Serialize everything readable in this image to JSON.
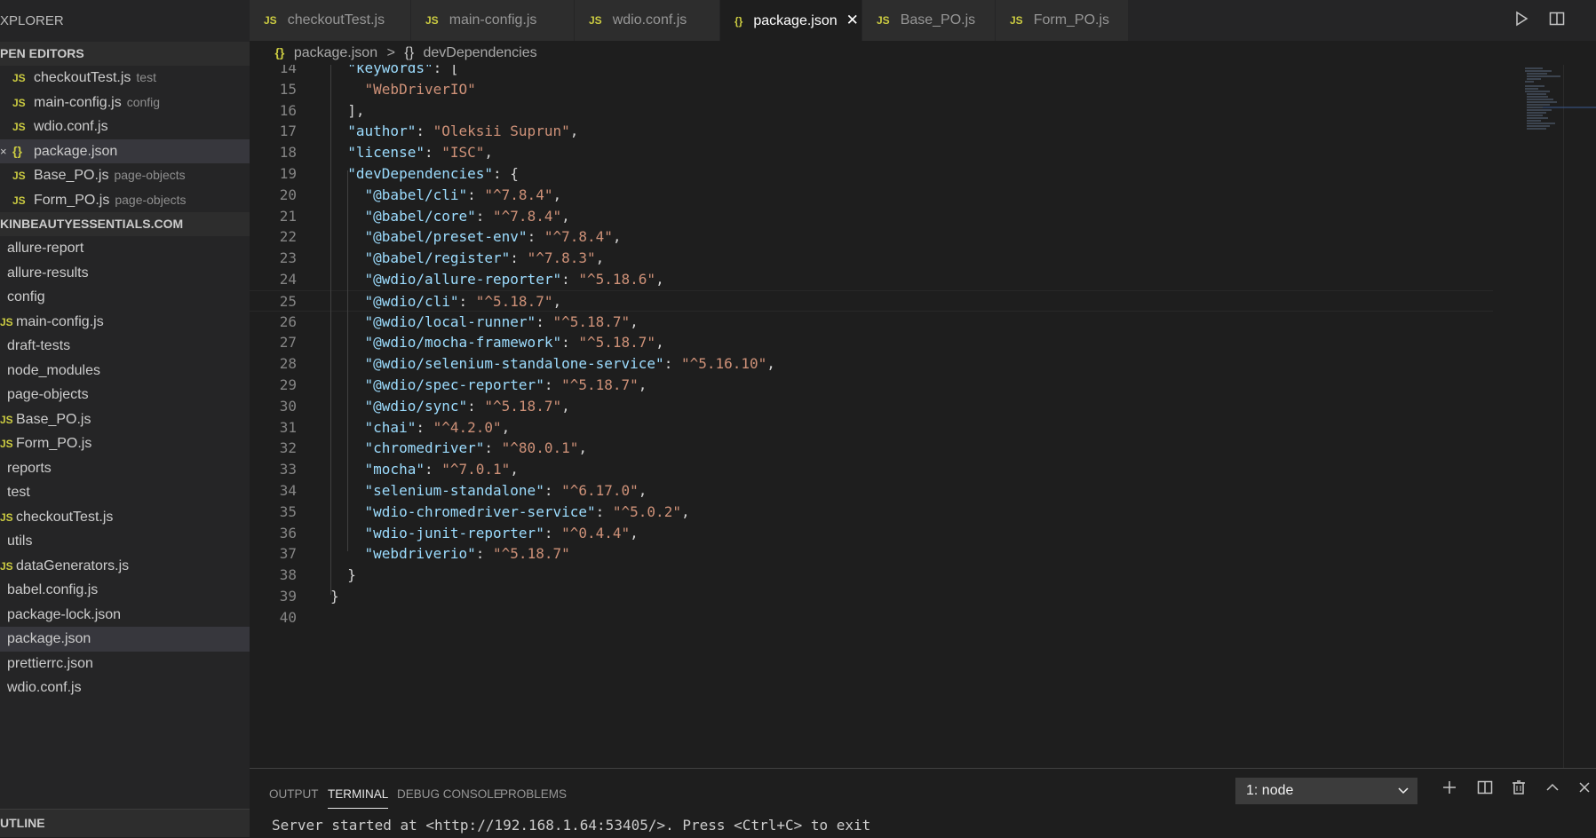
{
  "sidebar": {
    "header": "XPLORER",
    "open_editors_title": "PEN EDITORS",
    "open_editors": [
      {
        "icon": "JS",
        "name": "checkoutTest.js",
        "desc": "test"
      },
      {
        "icon": "JS",
        "name": "main-config.js",
        "desc": "config"
      },
      {
        "icon": "JS",
        "name": "wdio.conf.js",
        "desc": ""
      },
      {
        "icon": "{}",
        "name": "package.json",
        "desc": "",
        "close": "×"
      },
      {
        "icon": "JS",
        "name": "Base_PO.js",
        "desc": "page-objects"
      },
      {
        "icon": "JS",
        "name": "Form_PO.js",
        "desc": "page-objects"
      }
    ],
    "project_title": "KINBEAUTYESSENTIALS.COM",
    "tree": [
      {
        "icon": "",
        "name": "allure-report"
      },
      {
        "icon": "",
        "name": "allure-results"
      },
      {
        "icon": "",
        "name": "config"
      },
      {
        "icon": "JS",
        "name": "main-config.js"
      },
      {
        "icon": "",
        "name": "draft-tests"
      },
      {
        "icon": "",
        "name": "node_modules"
      },
      {
        "icon": "",
        "name": "page-objects"
      },
      {
        "icon": "JS",
        "name": "Base_PO.js"
      },
      {
        "icon": "JS",
        "name": "Form_PO.js"
      },
      {
        "icon": "",
        "name": "reports"
      },
      {
        "icon": "",
        "name": "test"
      },
      {
        "icon": "JS",
        "name": "checkoutTest.js"
      },
      {
        "icon": "",
        "name": "utils"
      },
      {
        "icon": "JS",
        "name": "dataGenerators.js"
      },
      {
        "icon": "",
        "name": "babel.config.js"
      },
      {
        "icon": "",
        "name": "package-lock.json"
      },
      {
        "icon": "",
        "name": "package.json"
      },
      {
        "icon": "",
        "name": "prettierrc.json"
      },
      {
        "icon": "",
        "name": "wdio.conf.js"
      }
    ],
    "outline_title": "UTLINE"
  },
  "tabs": [
    {
      "icon": "JS",
      "label": "checkoutTest.js"
    },
    {
      "icon": "JS",
      "label": "main-config.js"
    },
    {
      "icon": "JS",
      "label": "wdio.conf.js"
    },
    {
      "icon": "{}",
      "label": "package.json",
      "close": "✕"
    },
    {
      "icon": "JS",
      "label": "Base_PO.js"
    },
    {
      "icon": "JS",
      "label": "Form_PO.js"
    }
  ],
  "breadcrumb": {
    "file_icon": "{}",
    "file": "package.json",
    "sep": ">",
    "node_icon": "{}",
    "node": "devDependencies"
  },
  "editor": {
    "lines": [
      {
        "n": "14",
        "indent": "  ",
        "key": "\"keywords\"",
        "value": "",
        "punct": ": ["
      },
      {
        "n": "15",
        "indent": "    ",
        "key": "",
        "value": "\"WebDriverIO\"",
        "punct": ""
      },
      {
        "n": "16",
        "indent": "  ",
        "key": "",
        "value": "",
        "punct": "],"
      },
      {
        "n": "17",
        "indent": "  ",
        "key": "\"author\"",
        "value": "\"Oleksii Suprun\"",
        "punct": ","
      },
      {
        "n": "18",
        "indent": "  ",
        "key": "\"license\"",
        "value": "\"ISC\"",
        "punct": ","
      },
      {
        "n": "19",
        "indent": "  ",
        "key": "\"devDependencies\"",
        "value": "",
        "punct": ": {"
      },
      {
        "n": "20",
        "indent": "    ",
        "key": "\"@babel/cli\"",
        "value": "\"^7.8.4\"",
        "punct": ","
      },
      {
        "n": "21",
        "indent": "    ",
        "key": "\"@babel/core\"",
        "value": "\"^7.8.4\"",
        "punct": ","
      },
      {
        "n": "22",
        "indent": "    ",
        "key": "\"@babel/preset-env\"",
        "value": "\"^7.8.4\"",
        "punct": ","
      },
      {
        "n": "23",
        "indent": "    ",
        "key": "\"@babel/register\"",
        "value": "\"^7.8.3\"",
        "punct": ","
      },
      {
        "n": "24",
        "indent": "    ",
        "key": "\"@wdio/allure-reporter\"",
        "value": "\"^5.18.6\"",
        "punct": ","
      },
      {
        "n": "25",
        "indent": "    ",
        "key": "\"@wdio/cli\"",
        "value": "\"^5.18.7\"",
        "punct": ","
      },
      {
        "n": "26",
        "indent": "    ",
        "key": "\"@wdio/local-runner\"",
        "value": "\"^5.18.7\"",
        "punct": ","
      },
      {
        "n": "27",
        "indent": "    ",
        "key": "\"@wdio/mocha-framework\"",
        "value": "\"^5.18.7\"",
        "punct": ","
      },
      {
        "n": "28",
        "indent": "    ",
        "key": "\"@wdio/selenium-standalone-service\"",
        "value": "\"^5.16.10\"",
        "punct": ","
      },
      {
        "n": "29",
        "indent": "    ",
        "key": "\"@wdio/spec-reporter\"",
        "value": "\"^5.18.7\"",
        "punct": ","
      },
      {
        "n": "30",
        "indent": "    ",
        "key": "\"@wdio/sync\"",
        "value": "\"^5.18.7\"",
        "punct": ","
      },
      {
        "n": "31",
        "indent": "    ",
        "key": "\"chai\"",
        "value": "\"^4.2.0\"",
        "punct": ","
      },
      {
        "n": "32",
        "indent": "    ",
        "key": "\"chromedriver\"",
        "value": "\"^80.0.1\"",
        "punct": ","
      },
      {
        "n": "33",
        "indent": "    ",
        "key": "\"mocha\"",
        "value": "\"^7.0.1\"",
        "punct": ","
      },
      {
        "n": "34",
        "indent": "    ",
        "key": "\"selenium-standalone\"",
        "value": "\"^6.17.0\"",
        "punct": ","
      },
      {
        "n": "35",
        "indent": "    ",
        "key": "\"wdio-chromedriver-service\"",
        "value": "\"^5.0.2\"",
        "punct": ","
      },
      {
        "n": "36",
        "indent": "    ",
        "key": "\"wdio-junit-reporter\"",
        "value": "\"^0.4.4\"",
        "punct": ","
      },
      {
        "n": "37",
        "indent": "    ",
        "key": "\"webdriverio\"",
        "value": "\"^5.18.7\"",
        "punct": ""
      },
      {
        "n": "38",
        "indent": "  ",
        "key": "",
        "value": "",
        "punct": "}"
      },
      {
        "n": "39",
        "indent": "",
        "key": "",
        "value": "",
        "punct": "}"
      },
      {
        "n": "40",
        "indent": "",
        "key": "",
        "value": "",
        "punct": ""
      }
    ],
    "current_line": "25"
  },
  "panel": {
    "tabs": [
      "OUTPUT",
      "TERMINAL",
      "DEBUG CONSOLE",
      "PROBLEMS"
    ],
    "active_tab": "TERMINAL",
    "terminal_select": "1: node",
    "output": "Server started at <http://192.168.1.64:53405/>. Press <Ctrl+C> to exit"
  },
  "colors": {
    "sidebar_bg": "#252526",
    "editor_bg": "#1e1e1e",
    "json_key": "#9cdcfe",
    "json_string": "#ce9178",
    "js_icon": "#cbcb41"
  }
}
